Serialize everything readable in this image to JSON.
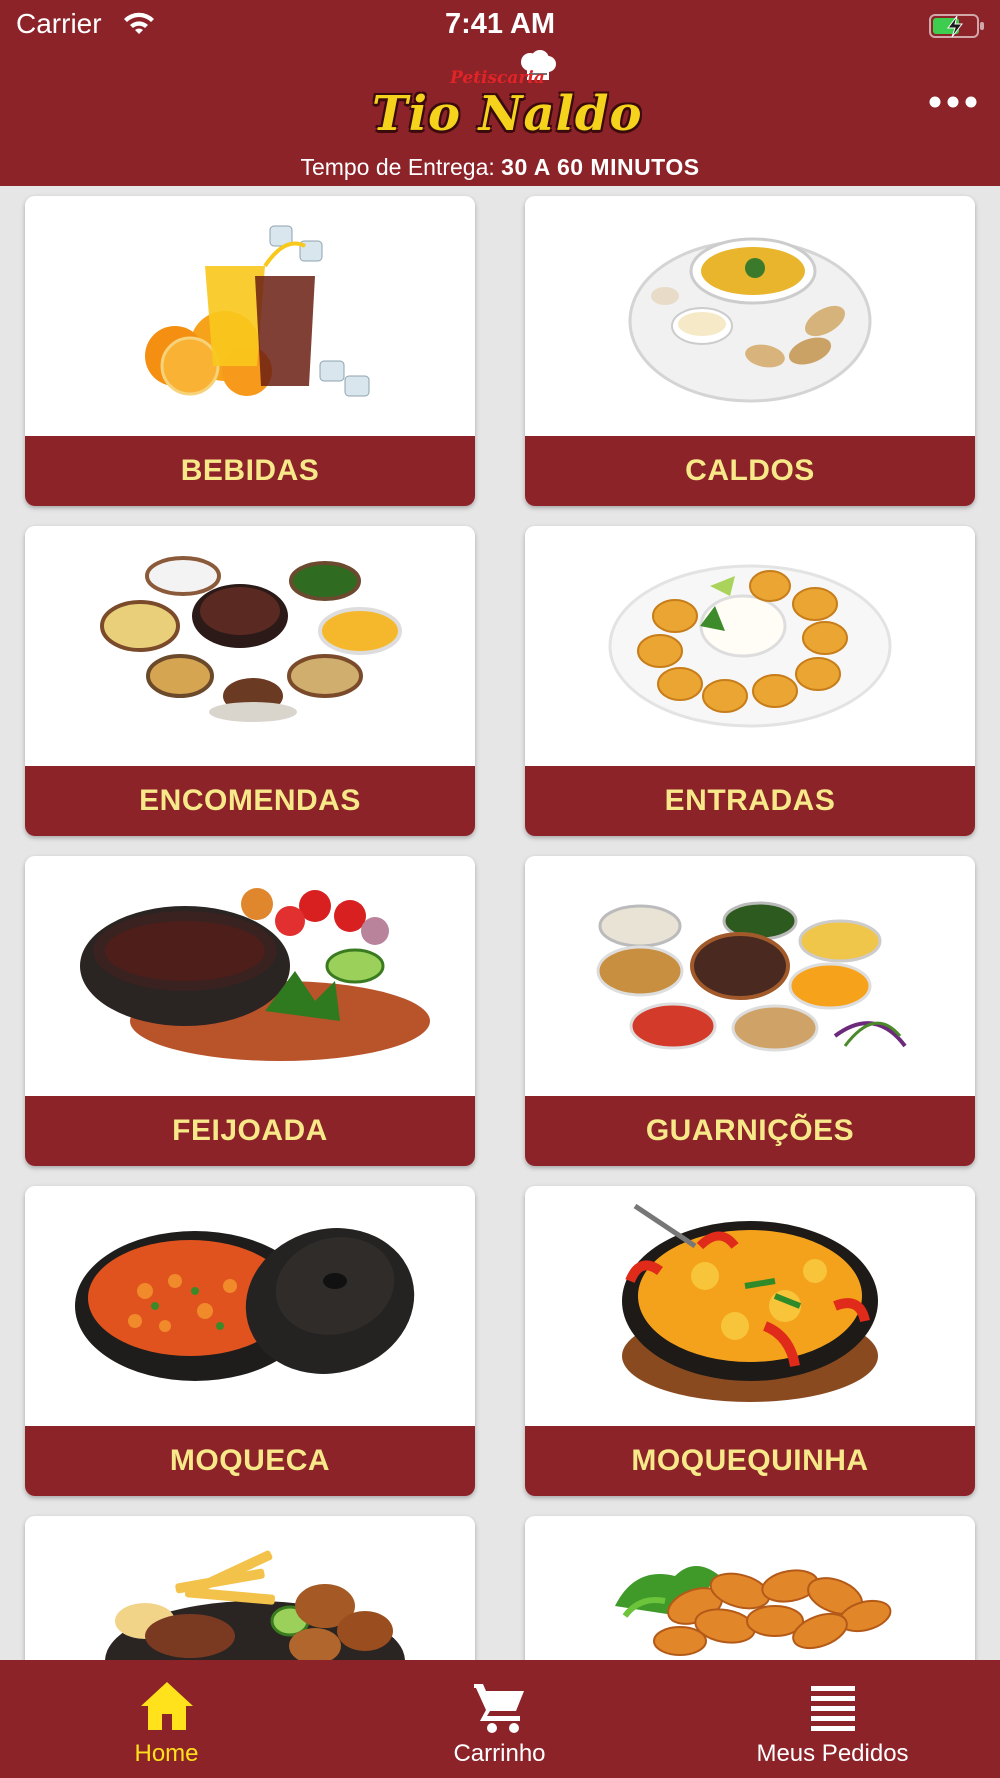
{
  "status_bar": {
    "carrier": "Carrier",
    "time": "7:41 AM"
  },
  "header": {
    "logo_small": "Petiscaria",
    "logo_big": "Tio Naldo",
    "delivery_label": "Tempo de Entrega:",
    "delivery_value": "30 A 60 MINUTOS"
  },
  "categories": [
    {
      "label": "BEBIDAS",
      "icon": "drinks-image"
    },
    {
      "label": "CALDOS",
      "icon": "soup-image"
    },
    {
      "label": "ENCOMENDAS",
      "icon": "feijoada-spread-image"
    },
    {
      "label": "ENTRADAS",
      "icon": "croquettes-image"
    },
    {
      "label": "FEIJOADA",
      "icon": "feijoada-pot-image"
    },
    {
      "label": "GUARNIÇÕES",
      "icon": "side-dishes-image"
    },
    {
      "label": "MOQUECA",
      "icon": "moqueca-pot-image"
    },
    {
      "label": "MOQUEQUINHA",
      "icon": "moquequinha-pan-image"
    },
    {
      "label": "",
      "icon": "mixed-grill-image"
    },
    {
      "label": "",
      "icon": "fried-snacks-image"
    }
  ],
  "tabbar": {
    "tabs": [
      {
        "label": "Home",
        "icon": "home-icon",
        "active": true
      },
      {
        "label": "Carrinho",
        "icon": "cart-icon",
        "active": false
      },
      {
        "label": "Meus Pedidos",
        "icon": "list-icon",
        "active": false
      }
    ]
  },
  "colors": {
    "brand": "#8c2329",
    "label_text": "#f7e98a",
    "active_tab": "#ffe11c",
    "background": "#e6e6e6"
  }
}
